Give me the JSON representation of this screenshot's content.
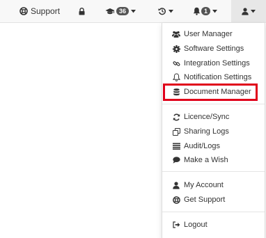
{
  "navbar": {
    "support_label": "Support",
    "courses_count": "36",
    "notifications_count": "1",
    "icons": [
      "support-icon",
      "lock-icon",
      "graduation-cap-icon",
      "history-icon",
      "bell-icon",
      "user-icon"
    ]
  },
  "menu": {
    "group1": [
      {
        "label": "User Manager",
        "icon": "users-icon"
      },
      {
        "label": "Software Settings",
        "icon": "gear-icon"
      },
      {
        "label": "Integration Settings",
        "icon": "link-icon"
      },
      {
        "label": "Notification Settings",
        "icon": "bell-outline-icon"
      },
      {
        "label": "Document Manager",
        "icon": "database-icon"
      }
    ],
    "group2": [
      {
        "label": "Licence/Sync",
        "icon": "refresh-icon"
      },
      {
        "label": "Sharing Logs",
        "icon": "copy-icon"
      },
      {
        "label": "Audit/Logs",
        "icon": "list-icon"
      },
      {
        "label": "Make a Wish",
        "icon": "comment-icon"
      }
    ],
    "group3": [
      {
        "label": "My Account",
        "icon": "user-icon"
      },
      {
        "label": "Get Support",
        "icon": "support-icon"
      }
    ],
    "group4": [
      {
        "label": "Logout",
        "icon": "sign-out-icon"
      }
    ]
  },
  "highlight": {
    "target": "Document Manager",
    "color": "#e0001a"
  },
  "colors": {
    "navbar_bg": "#f8f8f8",
    "active_bg": "#e7e7e7",
    "badge_bg": "#555555",
    "text": "#333333"
  }
}
